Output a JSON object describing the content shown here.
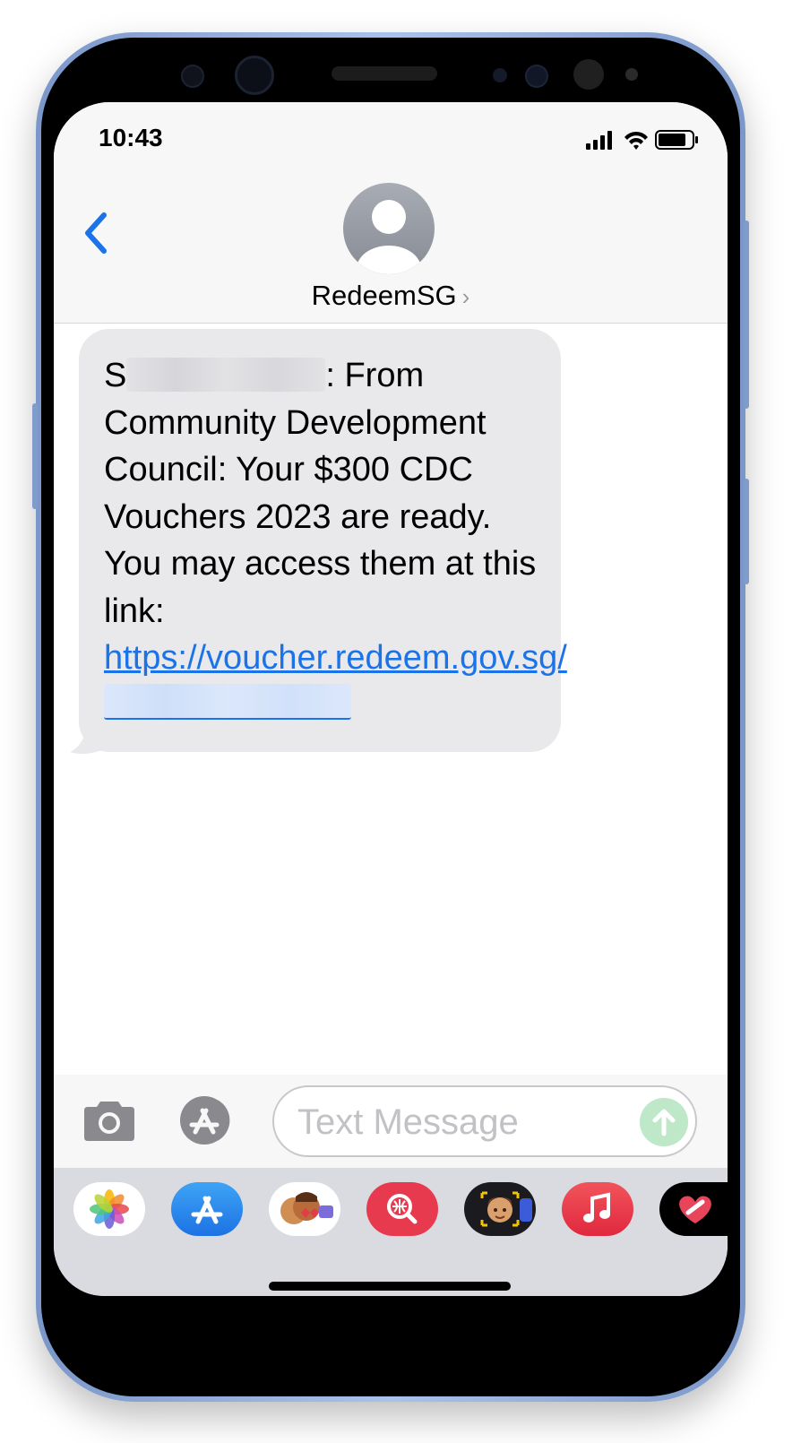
{
  "status_bar": {
    "time": "10:43"
  },
  "header": {
    "contact_name": "RedeemSG",
    "chevron": "›"
  },
  "message": {
    "sender_prefix": "S",
    "text_after_id": ": From Community Development Council: Your $300 CDC Vouchers 2023 are ready. You may access them at this link: ",
    "link_text": "https://voucher.redeem.gov.sg/"
  },
  "composer": {
    "placeholder": "Text Message"
  },
  "app_drawer": {
    "icons": [
      "photos-icon",
      "app-store-icon",
      "memoji-stickers-icon",
      "web-search-icon",
      "memoji-icon",
      "music-icon",
      "heart-sticker-icon"
    ]
  },
  "colors": {
    "accent": "#1a73e8",
    "bubble_received": "#e9e9eb",
    "send_disabled": "#bfe8c8",
    "phone_frame": "#a9c2ea"
  }
}
